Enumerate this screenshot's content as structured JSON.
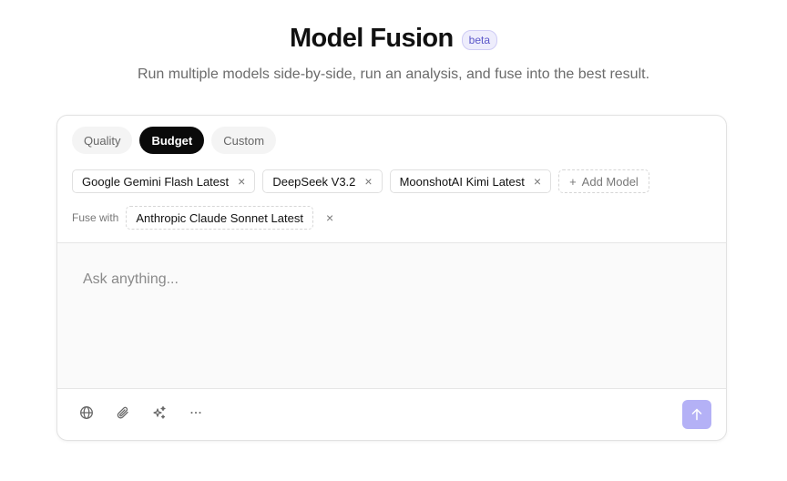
{
  "header": {
    "title": "Model Fusion",
    "badge": "beta",
    "subtitle": "Run multiple models side-by-side, run an analysis, and fuse into the best result."
  },
  "tabs": [
    {
      "label": "Quality",
      "active": false
    },
    {
      "label": "Budget",
      "active": true
    },
    {
      "label": "Custom",
      "active": false
    }
  ],
  "models": [
    {
      "label": "Google Gemini Flash Latest"
    },
    {
      "label": "DeepSeek V3.2"
    },
    {
      "label": "MoonshotAI Kimi Latest"
    }
  ],
  "add_model_label": "Add Model",
  "fuse": {
    "label": "Fuse with",
    "model": "Anthropic Claude Sonnet Latest"
  },
  "prompt": {
    "placeholder": "Ask anything...",
    "value": ""
  },
  "toolbar": {
    "icons": [
      "globe-icon",
      "paperclip-icon",
      "sparkles-icon",
      "more-icon",
      "arrow-up-icon"
    ]
  },
  "colors": {
    "accent": "#b4b1f6",
    "badge_text": "#5b57c9",
    "active_tab": "#0a0a0a"
  }
}
